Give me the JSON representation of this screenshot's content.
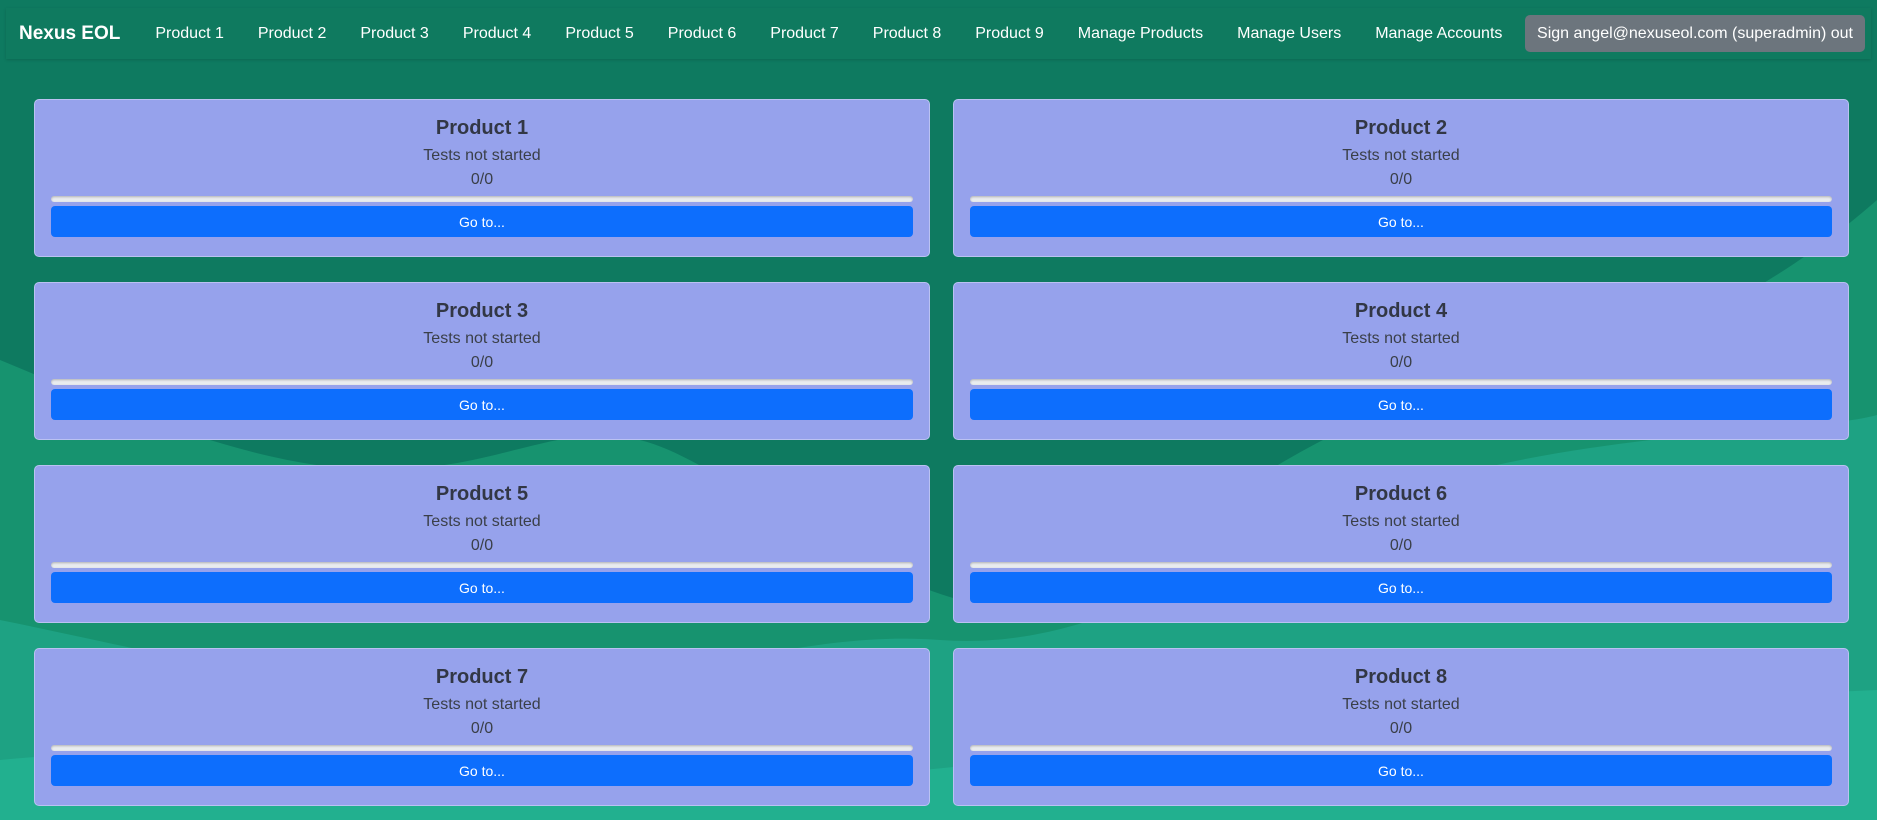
{
  "navbar": {
    "brand": "Nexus EOL",
    "links": [
      {
        "label": "Product 1"
      },
      {
        "label": "Product 2"
      },
      {
        "label": "Product 3"
      },
      {
        "label": "Product 4"
      },
      {
        "label": "Product 5"
      },
      {
        "label": "Product 6"
      },
      {
        "label": "Product 7"
      },
      {
        "label": "Product 8"
      },
      {
        "label": "Product 9"
      },
      {
        "label": "Manage Products"
      },
      {
        "label": "Manage Users"
      },
      {
        "label": "Manage Accounts"
      }
    ],
    "signout_label": "Sign angel@nexuseol.com (superadmin) out"
  },
  "colors": {
    "background": "#0e7a60",
    "card": "#96a2ec",
    "primary_button": "#0d6efd",
    "signout_button": "#6c757d"
  },
  "products": [
    {
      "title": "Product 1",
      "status": "Tests not started",
      "count": "0/0",
      "progress": 0,
      "button": "Go to..."
    },
    {
      "title": "Product 2",
      "status": "Tests not started",
      "count": "0/0",
      "progress": 0,
      "button": "Go to..."
    },
    {
      "title": "Product 3",
      "status": "Tests not started",
      "count": "0/0",
      "progress": 0,
      "button": "Go to..."
    },
    {
      "title": "Product 4",
      "status": "Tests not started",
      "count": "0/0",
      "progress": 0,
      "button": "Go to..."
    },
    {
      "title": "Product 5",
      "status": "Tests not started",
      "count": "0/0",
      "progress": 0,
      "button": "Go to..."
    },
    {
      "title": "Product 6",
      "status": "Tests not started",
      "count": "0/0",
      "progress": 0,
      "button": "Go to..."
    },
    {
      "title": "Product 7",
      "status": "Tests not started",
      "count": "0/0",
      "progress": 0,
      "button": "Go to..."
    },
    {
      "title": "Product 8",
      "status": "Tests not started",
      "count": "0/0",
      "progress": 0,
      "button": "Go to..."
    }
  ]
}
